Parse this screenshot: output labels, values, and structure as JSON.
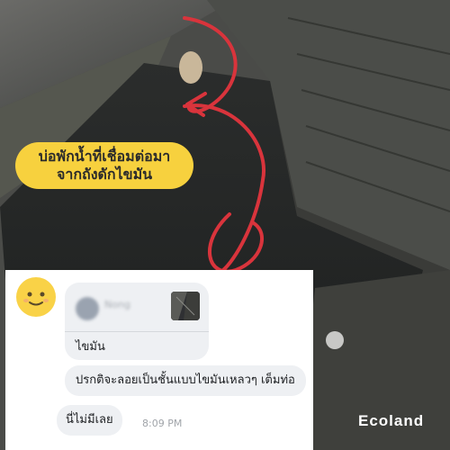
{
  "overlay": {
    "label_line1": "บ่อพักน้ำที่เชื่อมต่อมา",
    "label_line2": "จากถังดักไขมัน",
    "label_color": "#f7d13e",
    "arrow_color": "#d9343c"
  },
  "chat": {
    "quoted_name": "Nong",
    "quoted_message": "ไขมัน",
    "messages": [
      "ปรกติจะลอยเป็นชั้นแบบไขมันเหลวๆ เต็มท่อ",
      "นี่ไม่มีเลย"
    ],
    "timestamp": "8:09 PM"
  },
  "brand": {
    "name": "Ecoland"
  }
}
